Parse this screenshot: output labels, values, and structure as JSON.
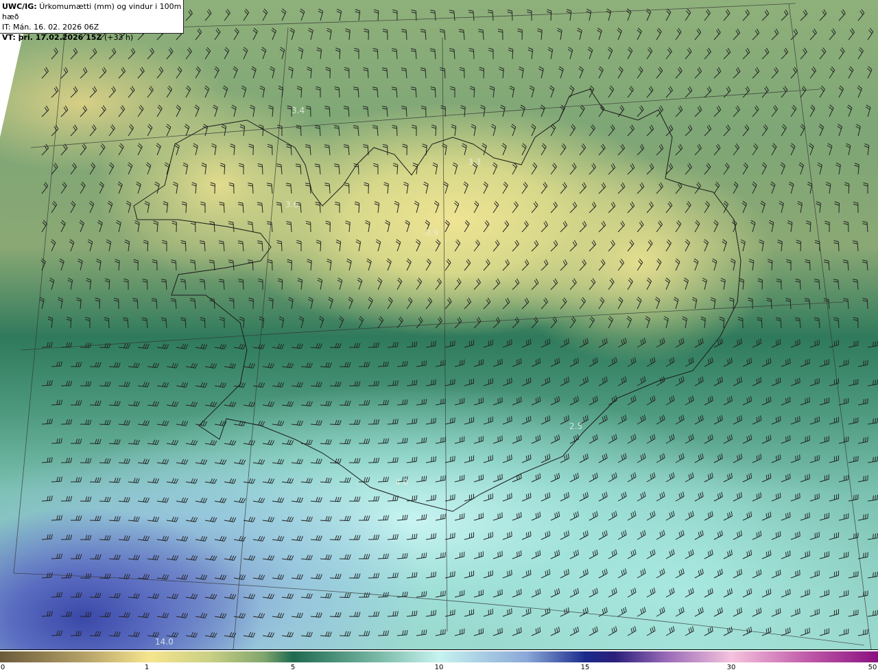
{
  "header": {
    "model_label": "UWC/IG:",
    "parameter": "Úrkomumætti (mm) og vindur i 100m hæð",
    "initial_time": "IT: Mán. 16. 02. 2026 06Z",
    "valid_label": "VT: þri. 17.02.2026 15Z",
    "lead_time": "(+33 h)"
  },
  "map_values": [
    "3.4",
    "3.3",
    "3.6",
    "0.9",
    "2.5",
    "4.0",
    "14.0"
  ],
  "colorbar": {
    "ticks": [
      "0",
      "1",
      "5",
      "10",
      "15",
      "30",
      "50"
    ]
  },
  "colors": {
    "land_outline": "#1a1a1a",
    "low": "#f6e58e",
    "mid": "#1f6a50",
    "high": "#1a2a8c"
  }
}
